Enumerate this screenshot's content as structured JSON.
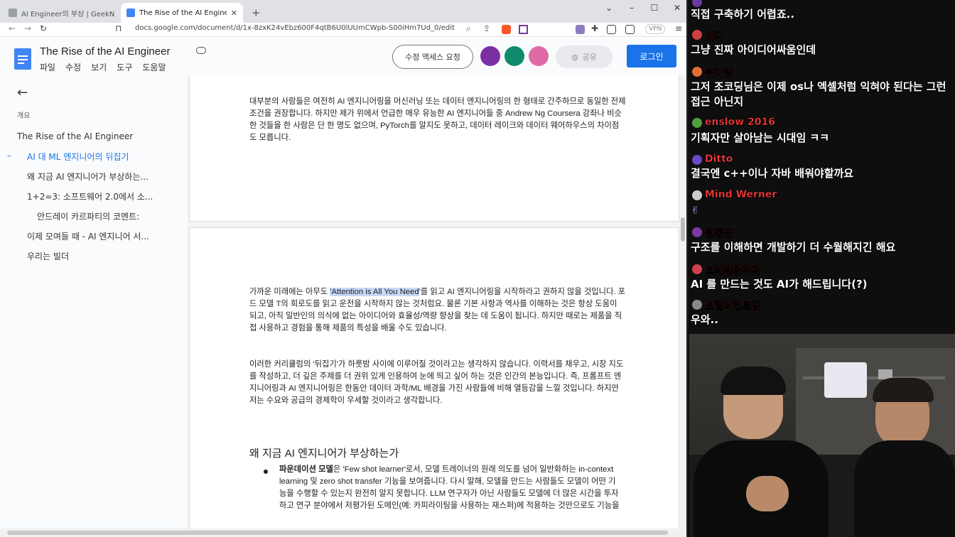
{
  "tabs": [
    {
      "title": "AI Engineer의 부상 | GeekNews",
      "active": false
    },
    {
      "title": "The Rise of the AI Engineer - Go",
      "active": true
    }
  ],
  "url": "docs.google.com/document/d/1x-8zxK24vEbz600F4qtB6U0lUUmCWpb-S00iHm7Ud_0/edit",
  "vpn_label": "VPN",
  "doc": {
    "title": "The Rise of the AI Engineer",
    "menus": [
      "파일",
      "수정",
      "보기",
      "도구",
      "도움말"
    ],
    "access_button": "수정 액세스 요청",
    "share_button": "공유",
    "login_button": "로그인"
  },
  "outline": {
    "header": "개요",
    "items": [
      {
        "label": "The Rise of the AI Engineer",
        "level": 0
      },
      {
        "label": "AI 대 ML 엔지니어의 뒤집기",
        "level": 1,
        "active": true
      },
      {
        "label": "왜 지금 AI 엔지니어가 부상하는...",
        "level": 1
      },
      {
        "label": "1+2=3: 소프트웨어 2.0에서 소...",
        "level": 1
      },
      {
        "label": "안드레이 카르파티의 코멘트:",
        "level": 2
      },
      {
        "label": "이제 모여들 때 - AI 엔지니어 서...",
        "level": 1
      },
      {
        "label": "우리는 빌더",
        "level": 1
      }
    ]
  },
  "content": {
    "para1": "대부분의 사람들은 여전히 AI 엔지니어링을 머신러닝 또는 데이터 엔지니어링의 한 형태로 간주하므로 동일한 전제 조건을 권장합니다. 하지만 제가 위에서 언급한 매우 유능한 AI 엔지니어들 중 Andrew Ng Coursera 강좌나 비슷한 것들을 한 사람은 단 한 명도 없으며, PyTorch를 알지도 못하고, 데이터 레이크와 데이터 웨어하우스의 차이점도 모릅니다.",
    "para2_pre": "가까운 미래에는 아무도 ",
    "para2_hl": "'Attention is All You Need",
    "para2_post": "'를 읽고 AI 엔지니어링을 시작하라고 권하지 않을 것입니다. 포드 모델 T의 회로도를 읽고 운전을 시작하지 않는 것처럼요. 물론 기본 사항과 역사를 이해하는 것은 항상 도움이 되고, 아직 일반인의 의식에 없는 아이디어와 효율성/역량 향상을 찾는 데 도움이 됩니다. 하지만 때로는 제품을 직접 사용하고 경험을 통해 제품의 특성을 배울 수도 있습니다.",
    "para3": "이러한 커리큘럼의 '뒤집기'가 하룻밤 사이에 이루어질 것이라고는 생각하지 않습니다. 이력서를 채우고, 시장 지도를 작성하고, 더 깊은 주제를 더 권위 있게 인용하여 눈에 띄고 싶어 하는 것은 인간의 본능입니다. 즉, 프롬프트 엔지니어링과 AI 엔지니어링은 한동안 데이터 과학/ML 배경을 가진 사람들에 비해 열등감을 느낄 것입니다. 하지만 저는 수요와 공급의 경제학이 우세할 것이라고 생각합니다.",
    "heading": "왜 지금 AI 엔지니어가 부상하는가",
    "bullet_bold": "파운데이션 모델",
    "bullet_text": "은 'Few shot learner'로서, 모델 트레이너의 원래 의도를 넘어 일반화하는 in-context learning 및 zero shot transfer 기능을 보여줍니다. 다시 말해, 모델을 만드는 사람들도 모델이 어떤 기능을 수행할 수 있는지 완전히 알지 못합니다. LLM 연구자가 아닌 사람들도 모델에 더 많은 시간을 투자하고 연구 분야에서 저평가된 도메인(예: 카피라이팅을 사용하는 재스퍼)에 적용하는 것만으로도 기능을"
  },
  "chat": [
    {
      "name": "",
      "msg": "직접 구축하기 어렵죠..",
      "badge": "#6a3aa0"
    },
    {
      "name": "에디",
      "msg": "그냥 진짜 아이디어싸움인데",
      "badge": "#d04040"
    },
    {
      "name": "쉬이람",
      "msg": "그저 조코딩님은 이제 os나 엑셀처럼 익혀야 된다는 그런 접근 아닌지",
      "badge": "#e07030"
    },
    {
      "name": "enslow 2016",
      "msg": "기획자만 살아남는 시대임 ㅋㅋ",
      "badge": "#50a040"
    },
    {
      "name": "Ditto",
      "msg": "결국엔 c++이나 자바 배워야할까요",
      "badge": "#6a4ac0"
    },
    {
      "name": "Mind Werner",
      "msg": "✌",
      "badge": "#cccccc"
    },
    {
      "name": "원동준",
      "msg": "구조를 이해하면 개발하기 더 수월해지긴 해요",
      "badge": "#7a3aa0"
    },
    {
      "name": "브레멘음악대",
      "msg": "AI 를 만드는 것도 AI가 해드립니다(?)",
      "badge": "#d04050"
    },
    {
      "name": "보릴리언트검",
      "msg": "우와..",
      "badge": "#888888"
    }
  ]
}
